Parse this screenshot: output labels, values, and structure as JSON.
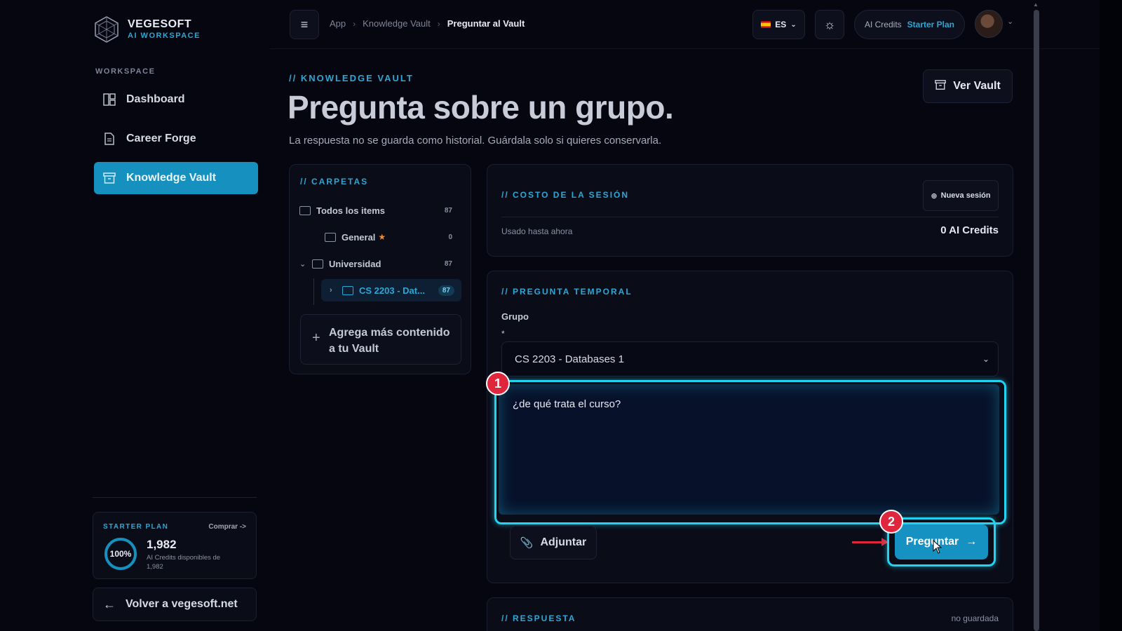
{
  "brand": {
    "name": "VEGESOFT",
    "sub": "AI WORKSPACE"
  },
  "sidebar": {
    "section_label": "WORKSPACE",
    "items": [
      {
        "label": "Dashboard",
        "icon": "dashboard-icon",
        "active": false
      },
      {
        "label": "Career Forge",
        "icon": "document-icon",
        "active": false
      },
      {
        "label": "Knowledge Vault",
        "icon": "archive-icon",
        "active": true
      }
    ],
    "plan": {
      "title": "STARTER PLAN",
      "buy": "Comprar ->",
      "percent": "100%",
      "credits": "1,982",
      "desc": "AI Credits disponibles de 1,982"
    },
    "back": "Volver a vegesoft.net"
  },
  "topbar": {
    "breadcrumbs": [
      "App",
      "Knowledge Vault",
      "Preguntar al Vault"
    ],
    "lang": "ES",
    "credits_label": "AI Credits",
    "credits_plan": "Starter Plan"
  },
  "page": {
    "eyebrow": "// KNOWLEDGE VAULT",
    "title": "Pregunta sobre un grupo.",
    "subtitle": "La respuesta no se guarda como historial. Guárdala solo si quieres conservarla.",
    "vault_button": "Ver Vault"
  },
  "folders": {
    "eyebrow": "// CARPETAS",
    "all": {
      "label": "Todos los items",
      "count": "87"
    },
    "general": {
      "label": "General",
      "count": "0"
    },
    "universidad": {
      "label": "Universidad",
      "count": "87"
    },
    "course": {
      "label": "CS 2203 - Dat...",
      "count": "87"
    },
    "add_more": "Agrega más contenido a tu Vault"
  },
  "cost": {
    "eyebrow": "// COSTO DE LA SESIÓN",
    "new_session": "Nueva sesión",
    "used_label": "Usado hasta ahora",
    "used_value": "0 AI Credits"
  },
  "ask": {
    "eyebrow": "// PREGUNTA TEMPORAL",
    "group_label": "Grupo",
    "required_mark": "*",
    "selected_group": "CS 2203 - Databases 1",
    "question": "¿de qué trata el curso?",
    "attach": "Adjuntar",
    "submit": "Preguntar",
    "badge1": "1",
    "badge2": "2"
  },
  "answer": {
    "eyebrow": "// RESPUESTA",
    "status": "no guardada"
  },
  "colors": {
    "accent": "#1592c2",
    "highlight": "#22d3f2",
    "badge": "#e0263c"
  }
}
